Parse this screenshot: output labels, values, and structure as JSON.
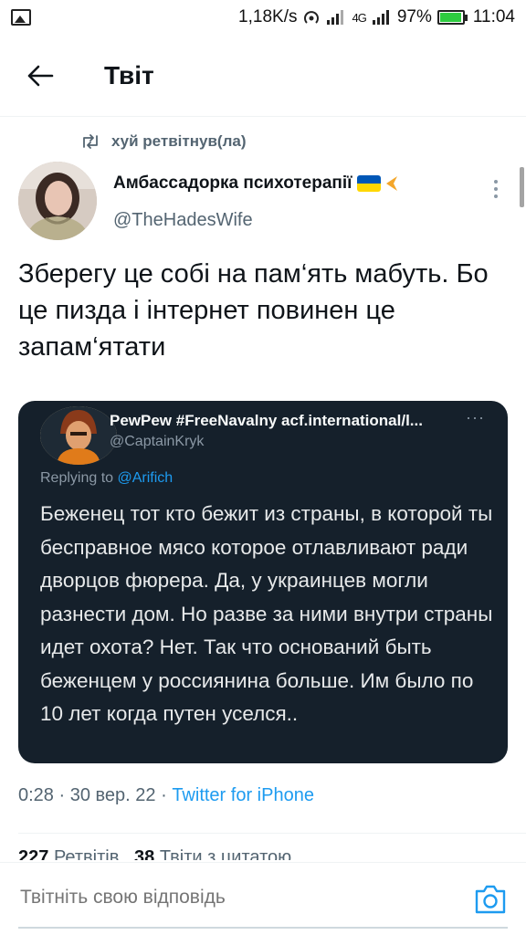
{
  "status_bar": {
    "speed": "1,18K/s",
    "network": "4G",
    "battery": "97%",
    "time": "11:04"
  },
  "header": {
    "title": "Твіт"
  },
  "retweet": {
    "label": "хуй ретвітнув(ла)"
  },
  "author": {
    "name": "Амбассадорка психотерапії",
    "handle": "@TheHadesWife",
    "flag_colors": [
      "#0057b7",
      "#ffd700"
    ]
  },
  "tweet": {
    "text": "Зберегу це собі на пам‘ять мабуть. Бо це пизда і інтернет повинен це запам‘ятати"
  },
  "quote": {
    "name": "PewPew #FreeNavalny acf.international/l...",
    "handle": "@CaptainKryk",
    "replying_prefix": "Replying to",
    "replying_to": "@Arifich",
    "text": "Беженец тот кто бежит из страны, в которой ты бесправное мясо которое отлавливают ради дворцов фюрера. Да, у украинцев могли разнести дом. Но разве за ними внутри страны идет охота? Нет. Так что оснований быть беженцем у россиянина больше. Им было по 10 лет когда путен уселся.."
  },
  "meta": {
    "time": "0:28",
    "date": "30 вер. 22",
    "source": "Twitter for iPhone"
  },
  "stats": {
    "retweets_count": "227",
    "retweets_label": "Ретвітів",
    "quotes_count": "38",
    "quotes_label": "Твіти з цитатою"
  },
  "reply": {
    "placeholder": "Твітніть свою відповідь"
  },
  "colors": {
    "accent": "#1d9bf0",
    "quote_bg": "#15202b",
    "secondary_text": "#536471"
  }
}
